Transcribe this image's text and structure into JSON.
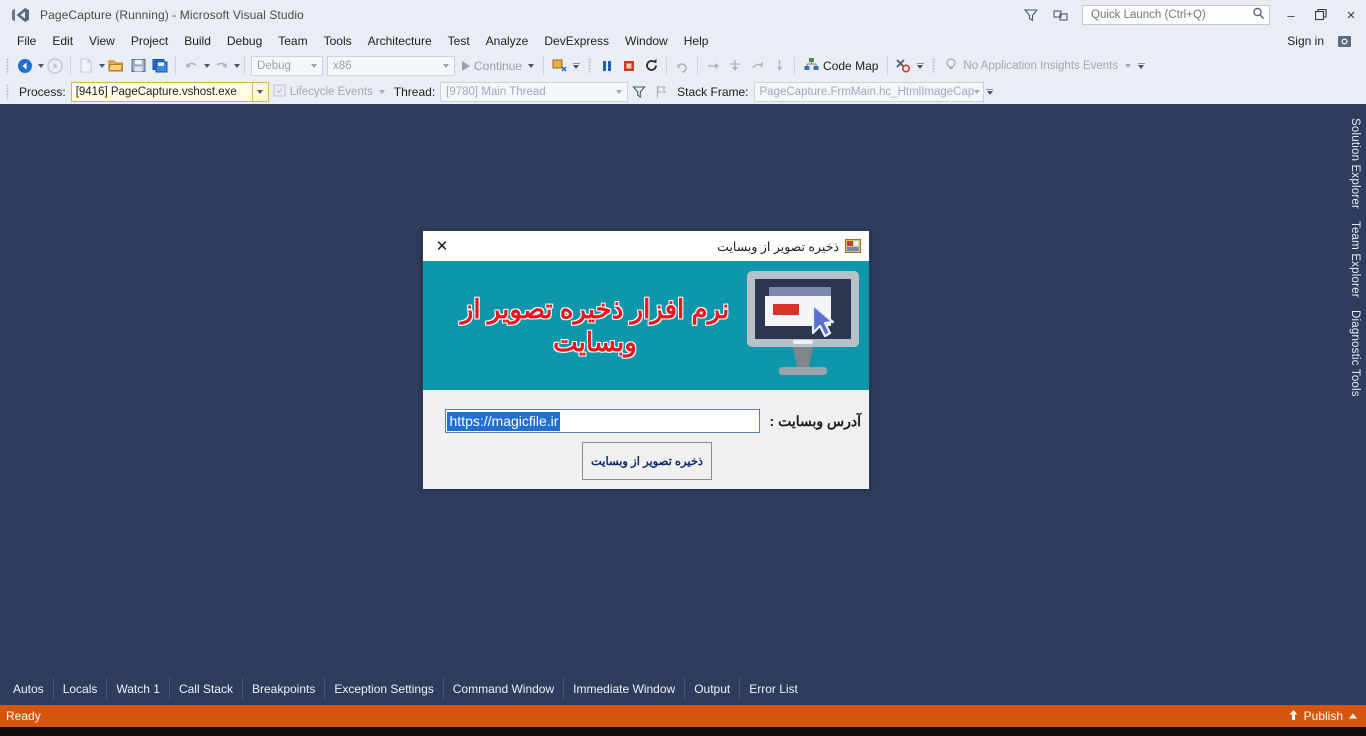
{
  "titlebar": {
    "title": "PageCapture (Running) - Microsoft Visual Studio",
    "logo_icon": "visual-studio-logo",
    "feedback_icon": "feedback-funnel-icon",
    "notify_icon": "notifications-icon",
    "quick_launch_placeholder": "Quick Launch (Ctrl+Q)",
    "quick_launch_value": "",
    "search_icon": "search-icon",
    "minimize_label": "–",
    "restore_label": "❐",
    "close_label": "×"
  },
  "menubar": {
    "items": [
      {
        "label": "File"
      },
      {
        "label": "Edit"
      },
      {
        "label": "View"
      },
      {
        "label": "Project"
      },
      {
        "label": "Build"
      },
      {
        "label": "Debug"
      },
      {
        "label": "Team"
      },
      {
        "label": "Tools"
      },
      {
        "label": "Architecture"
      },
      {
        "label": "Test"
      },
      {
        "label": "Analyze"
      },
      {
        "label": "DevExpress"
      },
      {
        "label": "Window"
      },
      {
        "label": "Help"
      }
    ],
    "sign_in": "Sign in",
    "feedback_icon": "send-feedback-icon"
  },
  "toolbar": {
    "navigate_back_icon": "navigate-back-icon",
    "navigate_forward_icon": "navigate-forward-icon",
    "new_item_icon": "new-item-icon",
    "open_file_icon": "open-file-icon",
    "save_icon": "save-icon",
    "save_all_icon": "save-all-icon",
    "undo_icon": "undo-icon",
    "redo_icon": "redo-icon",
    "config_value": "Debug",
    "platform_value": "x86",
    "continue_label": "Continue",
    "attach_icon": "attach-to-process-icon",
    "pause_icon": "pause-icon",
    "stop_icon": "stop-icon",
    "restart_icon": "restart-icon",
    "show_next_statement_icon": "show-next-statement-icon",
    "step_into_icon": "step-into-icon",
    "step_over_icon": "step-over-icon",
    "step_out_icon": "step-out-icon",
    "code_map_label": "Code Map",
    "code_map_icon": "code-map-icon",
    "intellitrace_icon": "intellitrace-icon",
    "insights_label": "No Application Insights Events",
    "insights_icon": "application-insights-icon",
    "overflow_icon": "toolbar-overflow-icon"
  },
  "debug_toolbar": {
    "process_label": "Process:",
    "process_value": "[9416] PageCapture.vshost.exe",
    "lifecycle_label": "Lifecycle Events",
    "lifecycle_icon": "lifecycle-events-icon",
    "thread_label": "Thread:",
    "thread_value": "[9780] Main Thread",
    "filter_icon": "filter-icon",
    "flag_icon": "flag-icon",
    "stack_frame_label": "Stack Frame:",
    "stack_frame_value": "PageCapture.FrmMain.hc_HtmlImageCap",
    "overflow_icon": "toolbar-overflow-icon"
  },
  "dock_right": {
    "tabs": [
      {
        "label": "Solution Explorer"
      },
      {
        "label": "Team Explorer"
      },
      {
        "label": "Diagnostic Tools"
      }
    ]
  },
  "app_dialog": {
    "window_icon": "application-window-icon",
    "title": "ذخیره تصویر از وبسایت",
    "close_label": "✕",
    "banner": {
      "headline": "نرم افزار ذخیره تصویر از وبسایت",
      "illustration_icon": "monitor-screenshot-cursor-icon",
      "background_color": "#0e97ab",
      "text_color": "#e8191e"
    },
    "form": {
      "url_label": "آدرس وبسایت :",
      "url_value": "https://magicfile.ir",
      "url_selected": true,
      "selection_color": "#1f6fd4",
      "save_button_label": "ذخیره تصویر از وبسایت"
    }
  },
  "debug_tabs": {
    "items": [
      {
        "label": "Autos"
      },
      {
        "label": "Locals"
      },
      {
        "label": "Watch 1"
      },
      {
        "label": "Call Stack"
      },
      {
        "label": "Breakpoints"
      },
      {
        "label": "Exception Settings"
      },
      {
        "label": "Command Window"
      },
      {
        "label": "Immediate Window"
      },
      {
        "label": "Output"
      },
      {
        "label": "Error List"
      }
    ]
  },
  "statusbar": {
    "status": "Ready",
    "publish_label": "Publish",
    "publish_icon": "publish-up-arrow-icon",
    "expander_icon": "chevron-up-icon",
    "background_color": "#d4550c"
  }
}
